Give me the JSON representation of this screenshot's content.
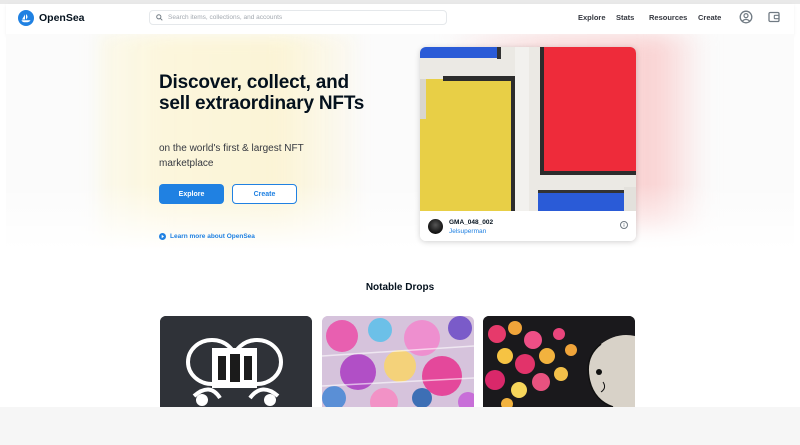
{
  "header": {
    "logo_text": "OpenSea",
    "search_placeholder": "Search items, collections, and accounts",
    "nav": [
      {
        "label": "Explore"
      },
      {
        "label": "Stats"
      },
      {
        "label": "Resources"
      },
      {
        "label": "Create"
      }
    ],
    "icons": [
      "profile-icon",
      "wallet-icon"
    ]
  },
  "hero": {
    "title": "Discover, collect, and sell extraordinary NFTs",
    "subtitle": "on the world's first & largest NFT marketplace",
    "explore_label": "Explore",
    "create_label": "Create",
    "learn_more": "Learn more about OpenSea"
  },
  "featured_card": {
    "name": "GMA_048_002",
    "creator": "Jelsuperman"
  },
  "notable": {
    "title": "Notable Drops",
    "drops": [
      "drop-1",
      "drop-2",
      "drop-3"
    ]
  },
  "colors": {
    "accent": "#2081e2",
    "text": "#04111d",
    "art_blue": "#2a5bd7",
    "art_yellow": "#e8cf46",
    "art_red": "#ee2b3a"
  }
}
